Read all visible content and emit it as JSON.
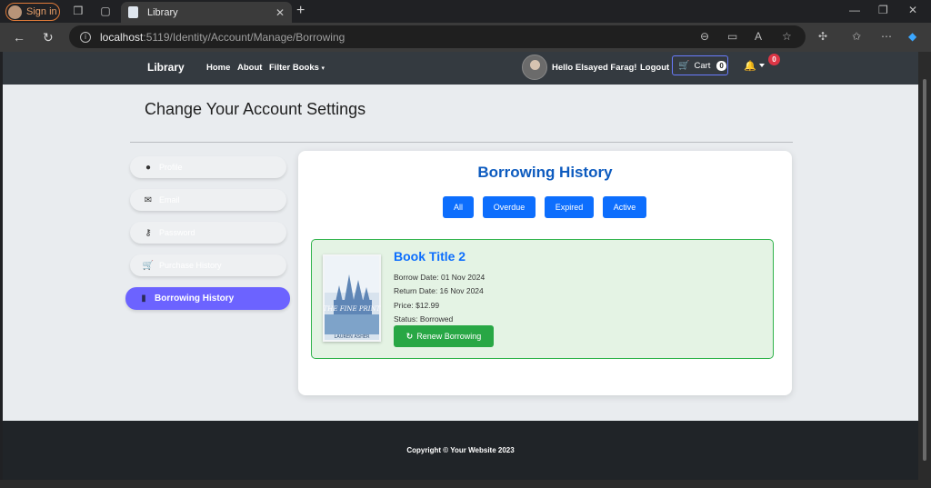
{
  "browser": {
    "signin_label": "Sign in",
    "tab_title": "Library",
    "url_host": "localhost",
    "url_rest": ":5119/Identity/Account/Manage/Borrowing"
  },
  "navbar": {
    "brand": "Library",
    "links": [
      "Home",
      "About",
      "Filter Books"
    ],
    "greeting": "Hello Elsayed Farag!",
    "logout": "Logout",
    "cart_label": "Cart",
    "cart_count": "0",
    "notification_count": "0"
  },
  "page": {
    "title": "Change Your Account Settings"
  },
  "sidebar": {
    "items": [
      {
        "label": "Profile",
        "icon": "user-circle-icon"
      },
      {
        "label": "Email",
        "icon": "envelope-icon"
      },
      {
        "label": "Password",
        "icon": "key-icon"
      },
      {
        "label": "Purchase History",
        "icon": "shopping-cart-icon"
      },
      {
        "label": "Borrowing History",
        "icon": "book-icon"
      }
    ]
  },
  "borrowing": {
    "title": "Borrowing History",
    "filters": [
      "All",
      "Overdue",
      "Expired",
      "Active"
    ],
    "book": {
      "title": "Book Title 2",
      "borrow_date": "Borrow Date: 01 Nov 2024",
      "return_date": "Return Date: 16 Nov 2024",
      "price": "Price: $12.99",
      "status": "Status: Borrowed",
      "cover_title": "THE FINE PRINT",
      "cover_author": "LAUREN ASHER",
      "renew_label": "Renew Borrowing"
    }
  },
  "footer": {
    "copyright": "Copyright © Your Website 2023"
  },
  "colors": {
    "accent": "#6c63ff",
    "primary": "#0d6efd",
    "success": "#28a745"
  }
}
